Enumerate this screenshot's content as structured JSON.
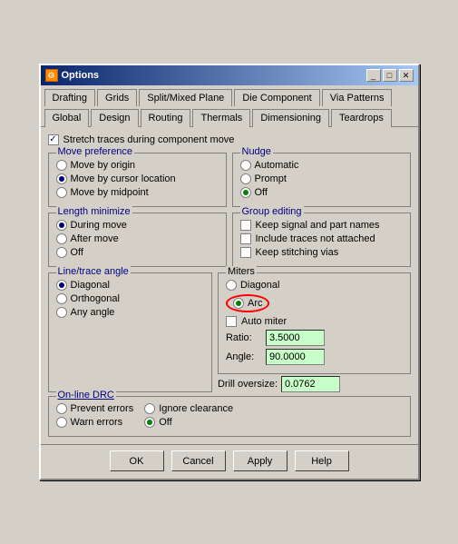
{
  "window": {
    "title": "Options",
    "icon": "⚙"
  },
  "tabs_row1": {
    "tabs": [
      "Drafting",
      "Grids",
      "Split/Mixed Plane",
      "Die Component",
      "Via Patterns"
    ]
  },
  "tabs_row2": {
    "tabs": [
      "Global",
      "Design",
      "Routing",
      "Thermals",
      "Dimensioning",
      "Teardrops"
    ],
    "active": "Design"
  },
  "stretch": {
    "label": "Stretch traces during component move",
    "checked": true
  },
  "move_preference": {
    "label": "Move preference",
    "options": [
      {
        "label": "Move by origin",
        "checked": false
      },
      {
        "label": "Move by cursor location",
        "checked": true
      },
      {
        "label": "Move by midpoint",
        "checked": false
      }
    ]
  },
  "nudge": {
    "label": "Nudge",
    "options": [
      {
        "label": "Automatic",
        "checked": false
      },
      {
        "label": "Prompt",
        "checked": false
      },
      {
        "label": "Off",
        "checked": true
      }
    ]
  },
  "length_minimize": {
    "label": "Length minimize",
    "options": [
      {
        "label": "During move",
        "checked": true
      },
      {
        "label": "After move",
        "checked": false
      },
      {
        "label": "Off",
        "checked": false
      }
    ]
  },
  "group_editing": {
    "label": "Group editing",
    "options": [
      {
        "label": "Keep signal and part names",
        "checked": false
      },
      {
        "label": "Include traces not attached",
        "checked": false
      },
      {
        "label": "Keep stitching vias",
        "checked": false
      }
    ]
  },
  "line_trace": {
    "label": "Line/trace angle",
    "options": [
      {
        "label": "Diagonal",
        "checked": true
      },
      {
        "label": "Orthogonal",
        "checked": false
      },
      {
        "label": "Any angle",
        "checked": false
      }
    ]
  },
  "miters": {
    "label": "Miters",
    "options": [
      {
        "label": "Diagonal",
        "checked": false
      },
      {
        "label": "Arc",
        "checked": true,
        "highlighted": true
      }
    ],
    "auto_miter": {
      "label": "Auto miter",
      "checked": false
    },
    "ratio": {
      "label": "Ratio:",
      "value": "3.5000"
    },
    "angle": {
      "label": "Angle:",
      "value": "90.0000"
    },
    "drill_oversize": {
      "label": "Drill oversize:",
      "value": "0.0762"
    }
  },
  "online_drc": {
    "label": "On-line DRC",
    "options": [
      {
        "label": "Prevent errors",
        "checked": false
      },
      {
        "label": "Warn errors",
        "checked": false
      },
      {
        "label": "Ignore clearance",
        "checked": false
      },
      {
        "label": "Off",
        "checked": true
      }
    ]
  },
  "buttons": {
    "ok": "OK",
    "cancel": "Cancel",
    "apply": "Apply",
    "help": "Help"
  }
}
